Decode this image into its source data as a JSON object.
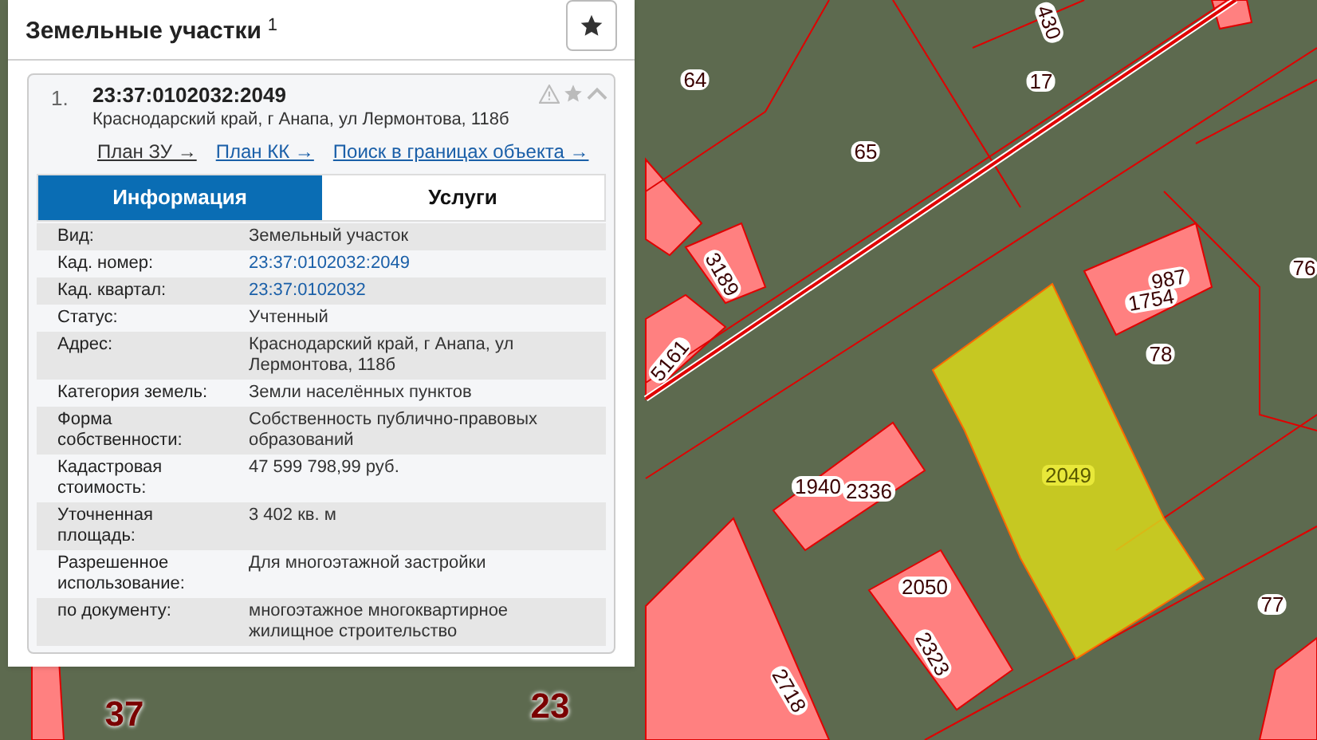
{
  "panel": {
    "title": "Земельные участки",
    "count": "1"
  },
  "result": {
    "index": "1.",
    "number": "23:37:0102032:2049",
    "address": "Краснодарский край, г Анапа, ул Лермонтова, 118б",
    "expanded": true,
    "links": [
      "План ЗУ →",
      "План КК →",
      "Поиск в границах объекта →"
    ]
  },
  "tabs": [
    {
      "label": "Информация",
      "selected": true
    },
    {
      "label": "Услуги",
      "selected": false
    }
  ],
  "rows": [
    {
      "label": "Вид:",
      "value": "Земельный участок",
      "kind": "text"
    },
    {
      "label": "Кад. номер:",
      "value": "23:37:0102032:2049",
      "kind": "link"
    },
    {
      "label": "Кад. квартал:",
      "value": "23:37:0102032",
      "kind": "link"
    },
    {
      "label": "Статус:",
      "value": "Учтенный",
      "kind": "text"
    },
    {
      "label": "Адрес:",
      "value": "Краснодарский край, г Анапа, ул Лермонтова, 118б",
      "kind": "text"
    },
    {
      "label": "Категория земель:",
      "value": "Земли населённых пунктов",
      "kind": "text"
    },
    {
      "label": "Форма собственности:",
      "value": "Собственность публично-правовых образований",
      "kind": "text"
    },
    {
      "label": "Кадастровая стоимость:",
      "value": "47 599 798,99 руб.",
      "kind": "text"
    },
    {
      "label": "Уточненная площадь:",
      "value": "3 402 кв. м",
      "kind": "text"
    },
    {
      "label": "Разрешенное использование:",
      "value": "Для многоэтажной застройки",
      "kind": "text"
    },
    {
      "label": "по документу:",
      "value": "многоэтажное многоквартирное жилищное строительство",
      "kind": "text"
    }
  ],
  "map": {
    "labels": [
      {
        "text": "64",
        "kind": "parcel",
        "selected": false
      },
      {
        "text": "65",
        "kind": "parcel",
        "selected": false
      },
      {
        "text": "17",
        "kind": "parcel",
        "selected": false
      },
      {
        "text": "430",
        "kind": "parcel",
        "selected": false
      },
      {
        "text": "987",
        "kind": "parcel",
        "selected": false
      },
      {
        "text": "1754",
        "kind": "parcel",
        "selected": false
      },
      {
        "text": "78",
        "kind": "parcel",
        "selected": false
      },
      {
        "text": "76",
        "kind": "parcel",
        "selected": false
      },
      {
        "text": "2049",
        "kind": "parcel",
        "selected": true
      },
      {
        "text": "1940",
        "kind": "parcel",
        "selected": false
      },
      {
        "text": "2336",
        "kind": "parcel",
        "selected": false
      },
      {
        "text": "2050",
        "kind": "parcel",
        "selected": false
      },
      {
        "text": "2323",
        "kind": "parcel",
        "selected": false
      },
      {
        "text": "2718",
        "kind": "parcel",
        "selected": false
      },
      {
        "text": "77",
        "kind": "parcel",
        "selected": false
      },
      {
        "text": "5161",
        "kind": "parcel",
        "selected": false
      },
      {
        "text": "3189",
        "kind": "parcel",
        "selected": false
      },
      {
        "text": "37",
        "kind": "quarter",
        "selected": false
      },
      {
        "text": "23",
        "kind": "quarter",
        "selected": false
      }
    ]
  }
}
